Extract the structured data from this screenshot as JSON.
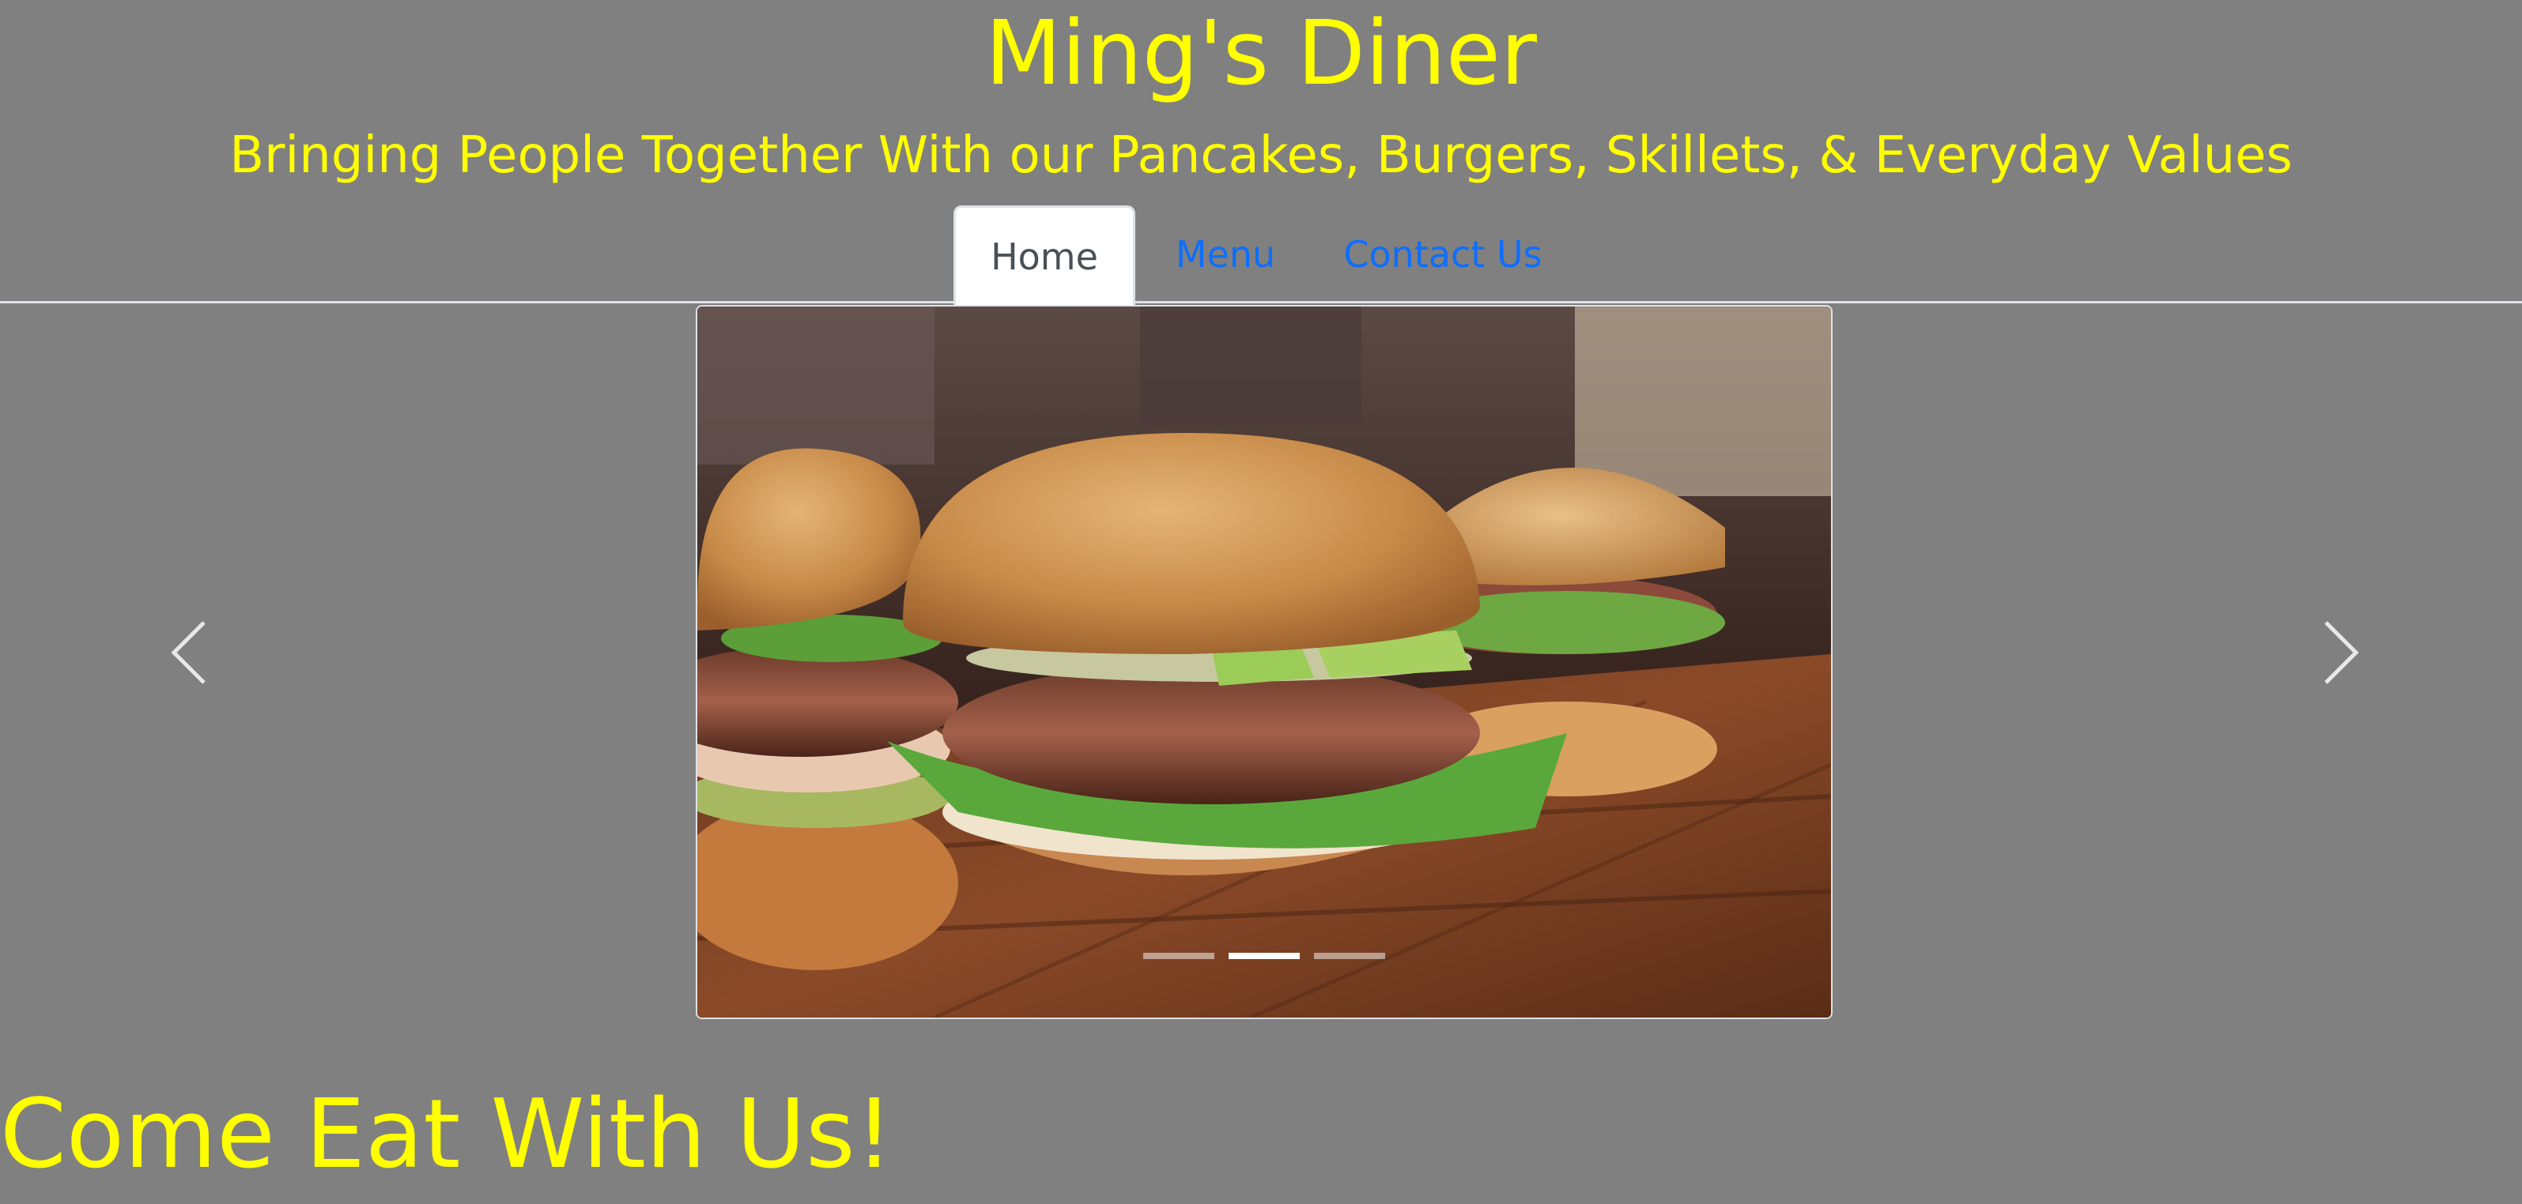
{
  "site": {
    "title": "Ming's Diner",
    "tagline": "Bringing People Together With our Pancakes, Burgers, Skillets, & Everyday Values"
  },
  "nav": {
    "tabs": [
      {
        "label": "Home",
        "active": true
      },
      {
        "label": "Menu",
        "active": false
      },
      {
        "label": "Contact Us",
        "active": false
      }
    ]
  },
  "carousel": {
    "slide_count": 3,
    "active_slide": 2,
    "image_subject": "burgers with avocado and lettuce on a wooden board",
    "prev_icon": "chevron-left-icon",
    "next_icon": "chevron-right-icon"
  },
  "main": {
    "heading": "Come Eat With Us!"
  },
  "colors": {
    "background": "#808080",
    "title": "#ffff00",
    "link": "#0d6efd",
    "active_tab_text": "#495057"
  }
}
